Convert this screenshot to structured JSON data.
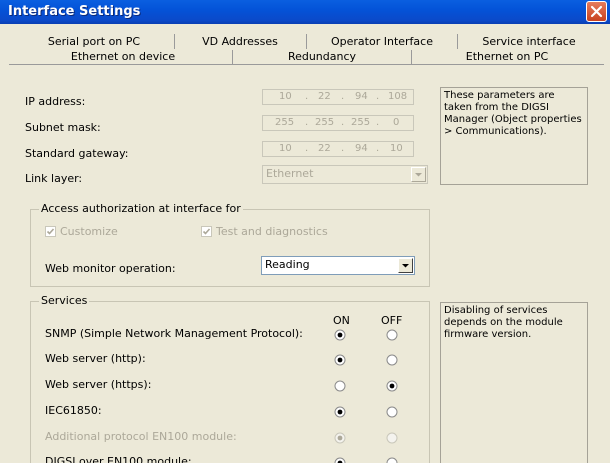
{
  "window": {
    "title": "Interface Settings"
  },
  "tabs_row1": [
    "Serial port on PC",
    "VD Addresses",
    "Operator Interface",
    "Service interface"
  ],
  "tabs_row2": [
    "Ethernet on device",
    "Redundancy",
    "Ethernet on PC"
  ],
  "network": {
    "ip_label": "IP address:",
    "ip": [
      "10",
      "22",
      "94",
      "108"
    ],
    "subnet_label": "Subnet mask:",
    "subnet": [
      "255",
      "255",
      "255",
      "0"
    ],
    "gateway_label": "Standard gateway:",
    "gateway": [
      "10",
      "22",
      "94",
      "10"
    ],
    "link_label": "Link layer:",
    "link_value": "Ethernet",
    "info": "These parameters are taken from the DIGSI Manager (Object properties > Communications)."
  },
  "access": {
    "legend": "Access authorization at interface for",
    "customize_label": "Customize",
    "customize_checked": true,
    "test_label": "Test and diagnostics",
    "test_checked": true,
    "web_label": "Web monitor operation:",
    "web_value": "Reading"
  },
  "services": {
    "legend": "Services",
    "on_label": "ON",
    "off_label": "OFF",
    "info": "Disabling of services depends on the module firmware version.",
    "rows": [
      {
        "label": "SNMP (Simple Network Management Protocol):",
        "state": "on",
        "enabled": true
      },
      {
        "label": "Web server (http):",
        "state": "on",
        "enabled": true
      },
      {
        "label": "Web server (https):",
        "state": "off",
        "enabled": true
      },
      {
        "label": "IEC61850:",
        "state": "on",
        "enabled": true
      },
      {
        "label": "Additional protocol EN100 module:",
        "state": "on",
        "enabled": false
      },
      {
        "label": "DIGSI over EN100 module:",
        "state": "on",
        "enabled": true
      }
    ]
  }
}
